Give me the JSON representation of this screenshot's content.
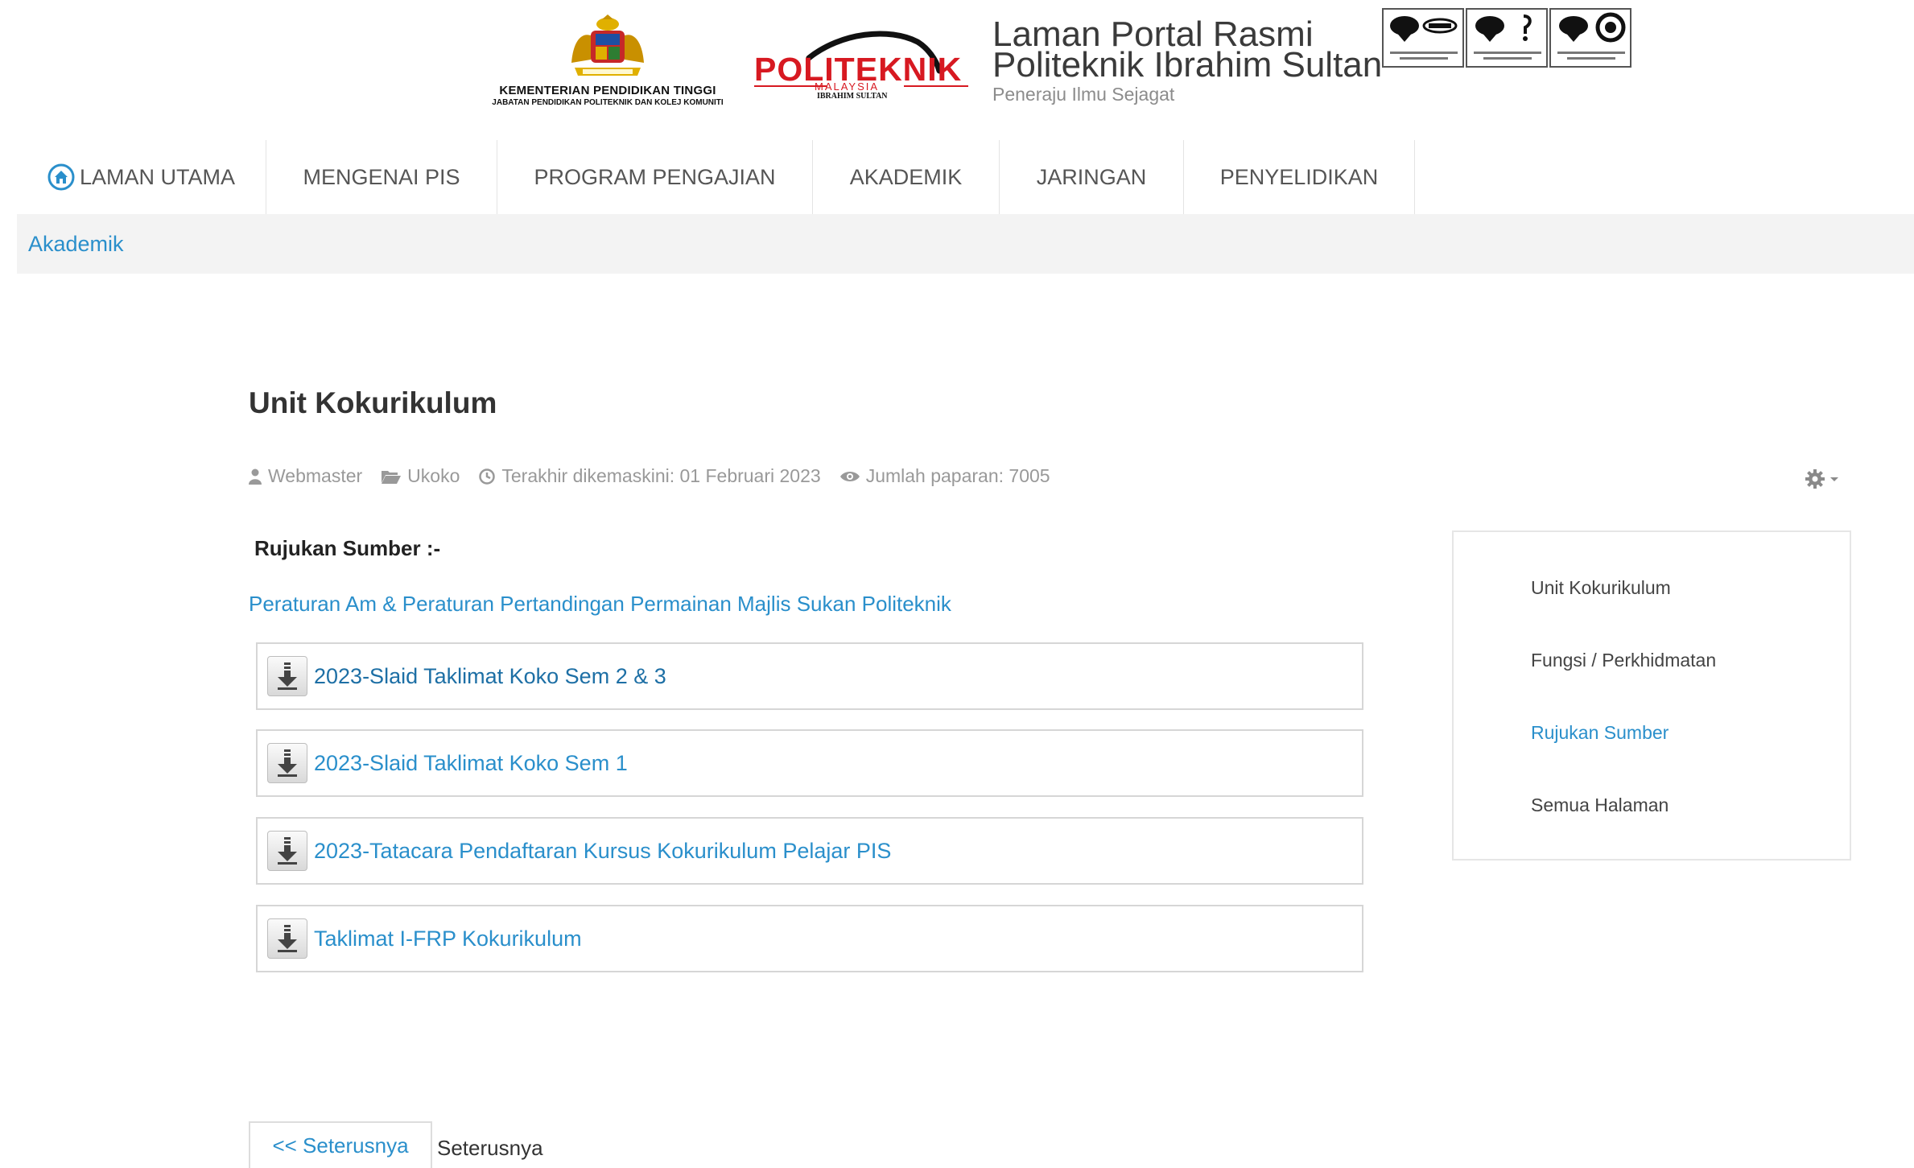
{
  "header": {
    "ministry_line1": "KEMENTERIAN PENDIDIKAN TINGGI",
    "ministry_line2": "JABATAN PENDIDIKAN POLITEKNIK DAN KOLEJ KOMUNITI",
    "poli_logo_text": "POLITEKNIK",
    "poli_sub1": "MALAYSIA",
    "poli_sub2": "IBRAHIM SULTAN",
    "site_title_line1": "Laman Portal Rasmi",
    "site_title_line2": "Politeknik Ibrahim Sultan",
    "tagline": "Peneraju Ilmu Sejagat"
  },
  "nav": {
    "items": [
      {
        "label": "LAMAN UTAMA",
        "icon": "home-icon"
      },
      {
        "label": "MENGENAI PIS"
      },
      {
        "label": "PROGRAM PENGAJIAN"
      },
      {
        "label": "AKADEMIK"
      },
      {
        "label": "JARINGAN"
      },
      {
        "label": "PENYELIDIKAN"
      }
    ]
  },
  "breadcrumb": {
    "label": "Akademik"
  },
  "article": {
    "title": "Unit Kokurikulum",
    "info": {
      "author": "Webmaster",
      "category": "Ukoko",
      "modified": "Terakhir dikemaskini: 01 Februari 2023",
      "hits": "Jumlah paparan: 7005"
    },
    "section_heading": "Rujukan Sumber :-",
    "rules_link": "Peraturan Am & Peraturan Pertandingan Permainan Majlis Sukan Politeknik",
    "downloads": [
      {
        "title": "2023-Slaid Taklimat Koko Sem 2 & 3"
      },
      {
        "title": "2023-Slaid Taklimat Koko Sem 1"
      },
      {
        "title": "2023-Tatacara Pendaftaran Kursus Kokurikulum Pelajar PIS"
      },
      {
        "title": "Taklimat I-FRP Kokurikulum"
      }
    ]
  },
  "sidebar": {
    "items": [
      {
        "label": "Unit Kokurikulum"
      },
      {
        "label": "Fungsi / Perkhidmatan"
      },
      {
        "label": "Rujukan Sumber",
        "active": true
      },
      {
        "label": "Semua Halaman"
      }
    ]
  },
  "pager": {
    "prev_label": "<< Seterusnya",
    "next_label": "Seterusnya"
  },
  "colors": {
    "link": "#2a8fcb",
    "brand_red": "#d71921",
    "nav_text": "#555555",
    "breadcrumb_bg": "#f3f3f3"
  }
}
